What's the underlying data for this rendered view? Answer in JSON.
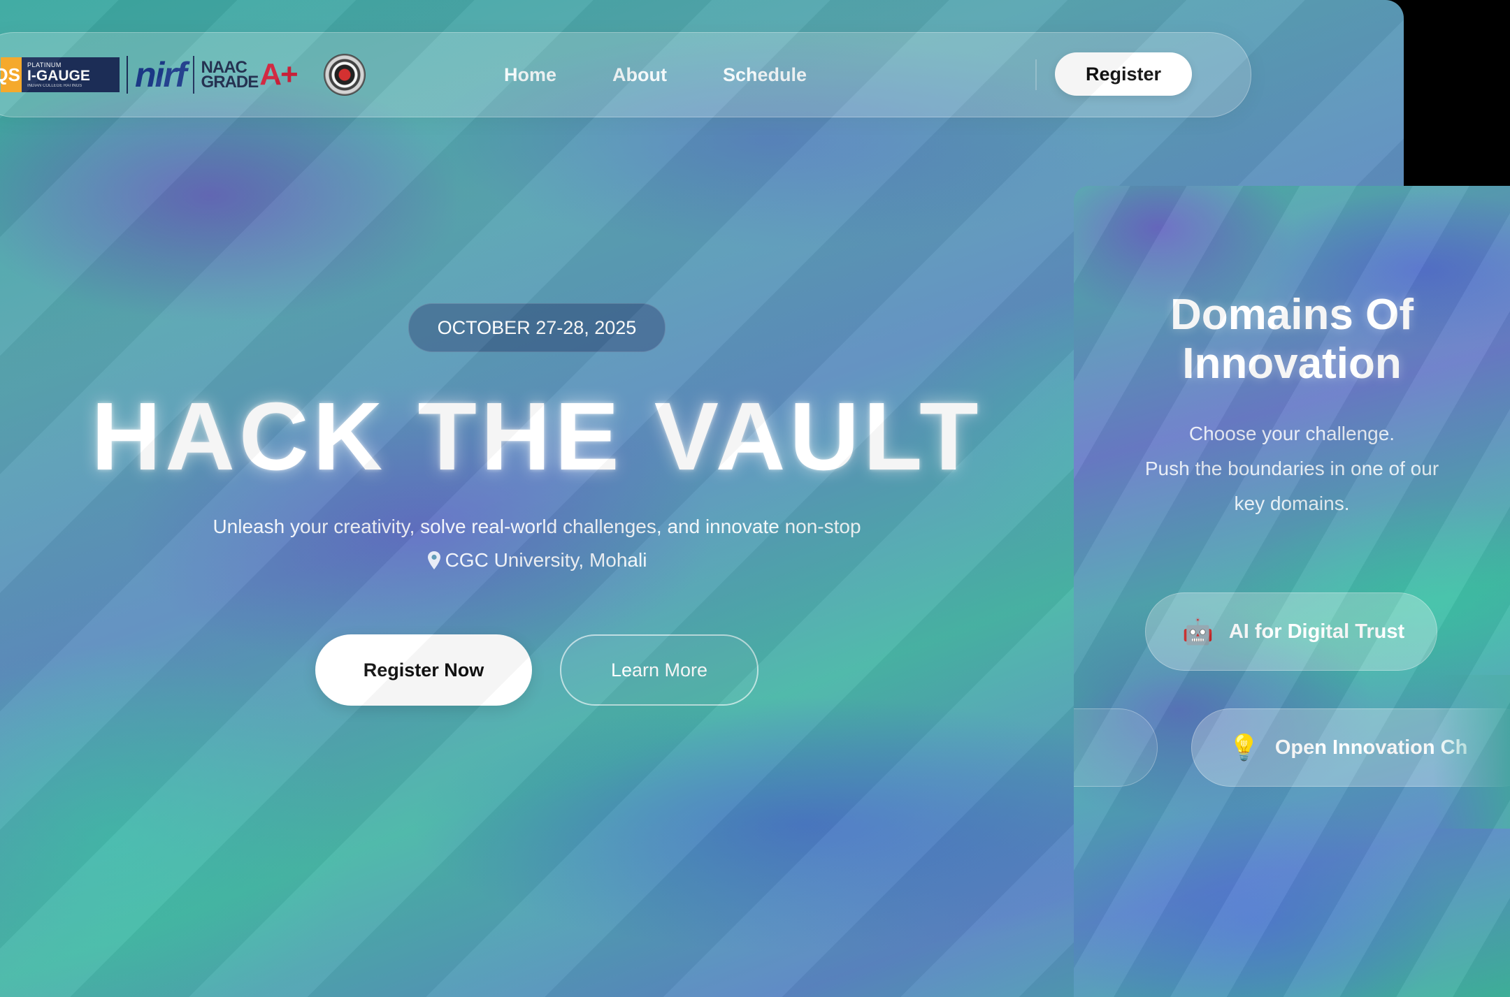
{
  "navbar": {
    "logos": {
      "qs_text": "QS",
      "igauge_platinum": "PLATINUM",
      "igauge_main": "I-GAUGE",
      "igauge_sub": "INDIAN COLLEGE RATINGS",
      "nirf": "nirf",
      "naac_line1": "NAAC",
      "naac_line2": "GRADE",
      "naac_grade": "A+"
    },
    "links": [
      "Home",
      "About",
      "Schedule"
    ],
    "register_label": "Register"
  },
  "hero": {
    "date": "OCTOBER 27-28, 2025",
    "title": "HACK THE VAULT",
    "subtitle": "Unleash your creativity, solve real-world challenges, and innovate non-stop",
    "location": "CGC University, Mohali",
    "primary_button": "Register Now",
    "secondary_button": "Learn More"
  },
  "domains": {
    "title_line1": "Domains Of",
    "title_line2": "Innovation",
    "desc_line1": "Choose your challenge.",
    "desc_line2": "Push the boundaries in one of our",
    "desc_line3": "key domains.",
    "items": [
      {
        "emoji": "🤖",
        "label": "AI for Digital Trust"
      },
      {
        "emoji": "💡",
        "label": "Open Innovation Ch"
      }
    ]
  },
  "colors": {
    "accent_white": "#ffffff",
    "naac_red": "#d0213b",
    "igauge_navy": "#1d2f5a",
    "qs_orange": "#f5a623"
  }
}
